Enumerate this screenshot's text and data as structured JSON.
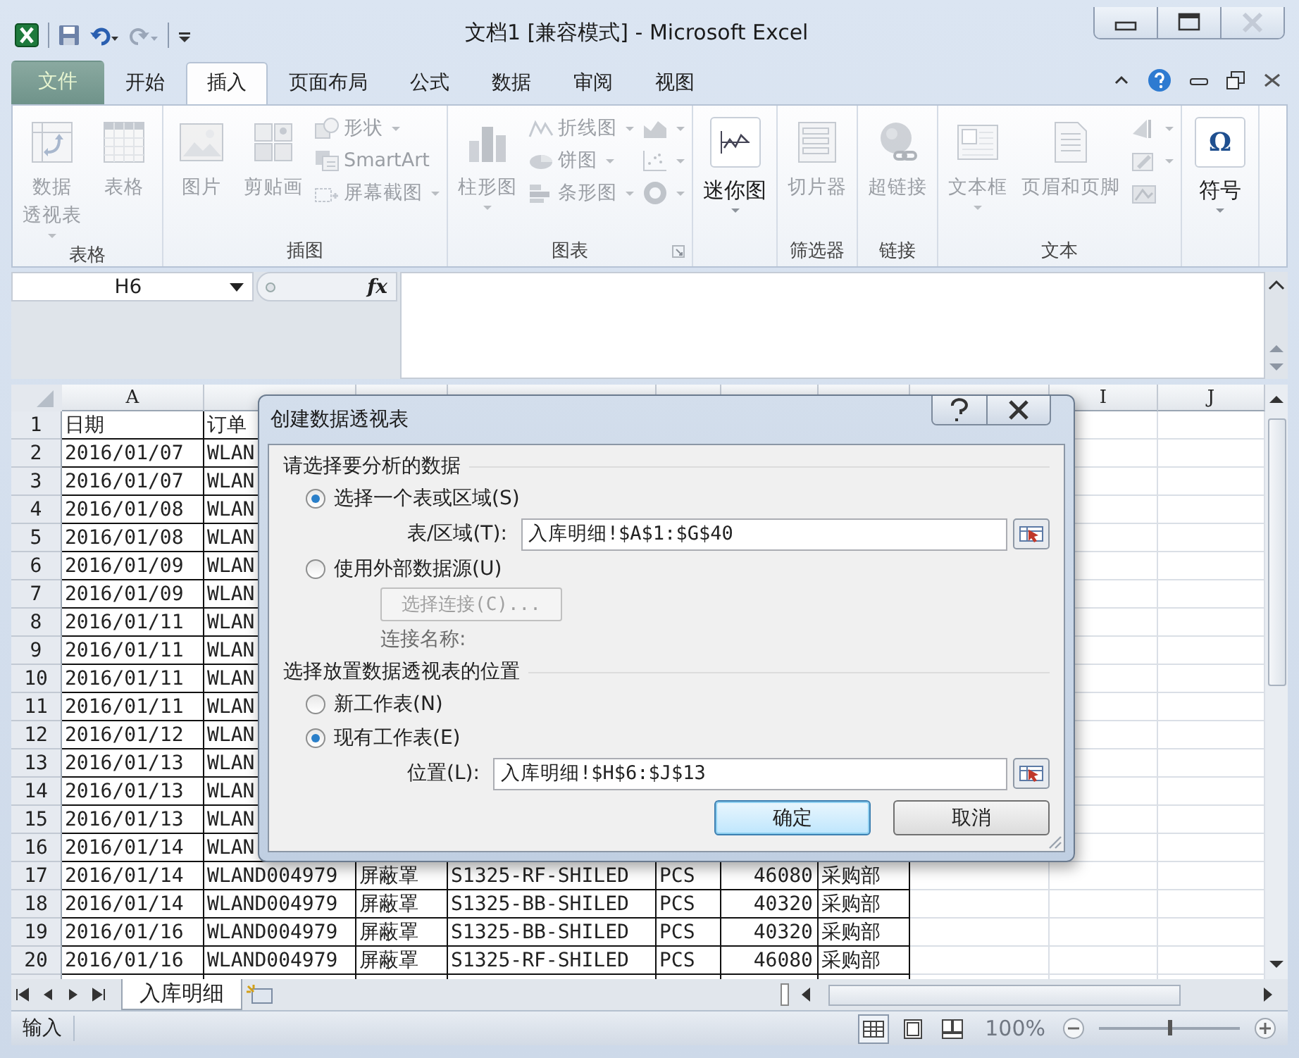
{
  "window": {
    "title": "文档1  [兼容模式] - Microsoft Excel"
  },
  "tabs": [
    {
      "label": "文件",
      "kind": "file",
      "selected": false
    },
    {
      "label": "开始",
      "kind": "tab",
      "selected": false
    },
    {
      "label": "插入",
      "kind": "tab",
      "selected": true
    },
    {
      "label": "页面布局",
      "kind": "tab",
      "selected": false
    },
    {
      "label": "公式",
      "kind": "tab",
      "selected": false
    },
    {
      "label": "数据",
      "kind": "tab",
      "selected": false
    },
    {
      "label": "审阅",
      "kind": "tab",
      "selected": false
    },
    {
      "label": "视图",
      "kind": "tab",
      "selected": false
    }
  ],
  "ribbon": {
    "groups": [
      {
        "label": "表格",
        "items": [
          {
            "kind": "large",
            "lines": [
              "数据",
              "透视表"
            ],
            "dropdown": true,
            "disabled": true
          },
          {
            "kind": "large",
            "label": "表格",
            "dropdown": false,
            "disabled": true
          }
        ]
      },
      {
        "label": "插图",
        "items": [
          {
            "kind": "large",
            "label": "图片",
            "dropdown": false,
            "disabled": true
          },
          {
            "kind": "large",
            "label": "剪贴画",
            "dropdown": false,
            "disabled": true
          },
          {
            "kind": "stack",
            "items": [
              {
                "label": "形状",
                "dropdown": true,
                "disabled": true
              },
              {
                "label": "SmartArt",
                "dropdown": false,
                "disabled": true
              },
              {
                "label": "屏幕截图",
                "dropdown": true,
                "disabled": true
              }
            ]
          }
        ]
      },
      {
        "label": "图表",
        "launcher": true,
        "items": [
          {
            "kind": "large",
            "label": "柱形图",
            "dropdown": true,
            "disabled": true
          },
          {
            "kind": "stack",
            "items": [
              {
                "label": "折线图",
                "dropdown": true,
                "disabled": true
              },
              {
                "label": "饼图",
                "dropdown": true,
                "disabled": true
              },
              {
                "label": "条形图",
                "dropdown": true,
                "disabled": true
              }
            ]
          },
          {
            "kind": "stack",
            "items": [
              {
                "dropdown": true,
                "disabled": true
              },
              {
                "dropdown": true,
                "disabled": true
              },
              {
                "dropdown": true,
                "disabled": true
              }
            ]
          }
        ]
      },
      {
        "items": [
          {
            "kind": "large",
            "label": "迷你图",
            "dropdown": true,
            "disabled": false
          }
        ]
      },
      {
        "label": "筛选器",
        "items": [
          {
            "kind": "large",
            "label": "切片器",
            "dropdown": false,
            "disabled": true
          }
        ]
      },
      {
        "label": "链接",
        "items": [
          {
            "kind": "large",
            "label": "超链接",
            "dropdown": false,
            "disabled": true
          }
        ]
      },
      {
        "label": "文本",
        "items": [
          {
            "kind": "large",
            "label": "文本框",
            "dropdown": true,
            "disabled": true
          },
          {
            "kind": "large",
            "label": "页眉和页脚",
            "dropdown": false,
            "disabled": true
          },
          {
            "kind": "stack",
            "items": [
              {
                "dropdown": true,
                "disabled": true
              },
              {
                "dropdown": true,
                "disabled": true
              },
              {
                "dropdown": false,
                "disabled": true
              }
            ]
          }
        ]
      },
      {
        "items": [
          {
            "kind": "large",
            "label": "符号",
            "glyph": "Ω",
            "dropdown": true,
            "disabled": false
          }
        ]
      }
    ]
  },
  "formula_bar": {
    "name_box": "H6",
    "fx": "fx"
  },
  "sheet": {
    "headers_left": [
      "A"
    ],
    "headers_right": [
      "I",
      "J"
    ],
    "rows": [
      {
        "number": "1",
        "cells": [
          "日期",
          "订单"
        ]
      },
      {
        "number": "2",
        "cells": [
          "2016/01/07",
          "WLAN"
        ]
      },
      {
        "number": "3",
        "cells": [
          "2016/01/07",
          "WLAN"
        ]
      },
      {
        "number": "4",
        "cells": [
          "2016/01/08",
          "WLAN"
        ]
      },
      {
        "number": "5",
        "cells": [
          "2016/01/08",
          "WLAN"
        ]
      },
      {
        "number": "6",
        "cells": [
          "2016/01/09",
          "WLAN"
        ]
      },
      {
        "number": "7",
        "cells": [
          "2016/01/09",
          "WLAN"
        ]
      },
      {
        "number": "8",
        "cells": [
          "2016/01/11",
          "WLAN"
        ]
      },
      {
        "number": "9",
        "cells": [
          "2016/01/11",
          "WLAN"
        ]
      },
      {
        "number": "10",
        "cells": [
          "2016/01/11",
          "WLAN"
        ]
      },
      {
        "number": "11",
        "cells": [
          "2016/01/11",
          "WLAN"
        ]
      },
      {
        "number": "12",
        "cells": [
          "2016/01/12",
          "WLAN"
        ]
      },
      {
        "number": "13",
        "cells": [
          "2016/01/13",
          "WLAN"
        ]
      },
      {
        "number": "14",
        "cells": [
          "2016/01/13",
          "WLAN"
        ]
      },
      {
        "number": "15",
        "cells": [
          "2016/01/13",
          "WLAN"
        ]
      },
      {
        "number": "16",
        "cells": [
          "2016/01/14",
          "WLAN"
        ]
      },
      {
        "number": "17",
        "cells": [
          "2016/01/14",
          "WLAND004979",
          "屏蔽罩",
          "S1325-RF-SHILED",
          "PCS",
          "46080",
          "采购部"
        ]
      },
      {
        "number": "18",
        "cells": [
          "2016/01/14",
          "WLAND004979",
          "屏蔽罩",
          "S1325-BB-SHILED",
          "PCS",
          "40320",
          "采购部"
        ]
      },
      {
        "number": "19",
        "cells": [
          "2016/01/16",
          "WLAND004979",
          "屏蔽罩",
          "S1325-BB-SHILED",
          "PCS",
          "40320",
          "采购部"
        ]
      },
      {
        "number": "20",
        "cells": [
          "2016/01/16",
          "WLAND004979",
          "屏蔽罩",
          "S1325-RF-SHILED",
          "PCS",
          "46080",
          "采购部"
        ]
      }
    ]
  },
  "sheet_tabs": [
    {
      "label": "入库明细",
      "selected": true
    }
  ],
  "status_bar": {
    "mode": "输入",
    "views": [
      {
        "selected": true
      },
      {
        "selected": false
      },
      {
        "selected": false
      }
    ],
    "zoom": "100%",
    "zoom_level": {
      "level": 0.5
    }
  },
  "dialog": {
    "title": "创建数据透视表",
    "sections": [
      {
        "heading": "请选择要分析的数据",
        "options": [
          {
            "label": "选择一个表或区域(S)",
            "selected": true,
            "field": {
              "label": "表/区域(T):",
              "value": "入库明细!$A$1:$G$40"
            }
          },
          {
            "label": "使用外部数据源(U)",
            "selected": false,
            "button": {
              "label": "选择连接(C)...",
              "disabled": true
            },
            "note": {
              "label": "连接名称:",
              "disabled": true
            }
          }
        ]
      },
      {
        "heading": "选择放置数据透视表的位置",
        "options": [
          {
            "label": "新工作表(N)",
            "selected": false
          },
          {
            "label": "现有工作表(E)",
            "selected": true
          }
        ],
        "field": {
          "label": "位置(L):",
          "value": "入库明细!$H$6:$J$13"
        }
      }
    ],
    "buttons": [
      {
        "label": "确定",
        "default": true
      },
      {
        "label": "取消",
        "default": false
      }
    ]
  }
}
